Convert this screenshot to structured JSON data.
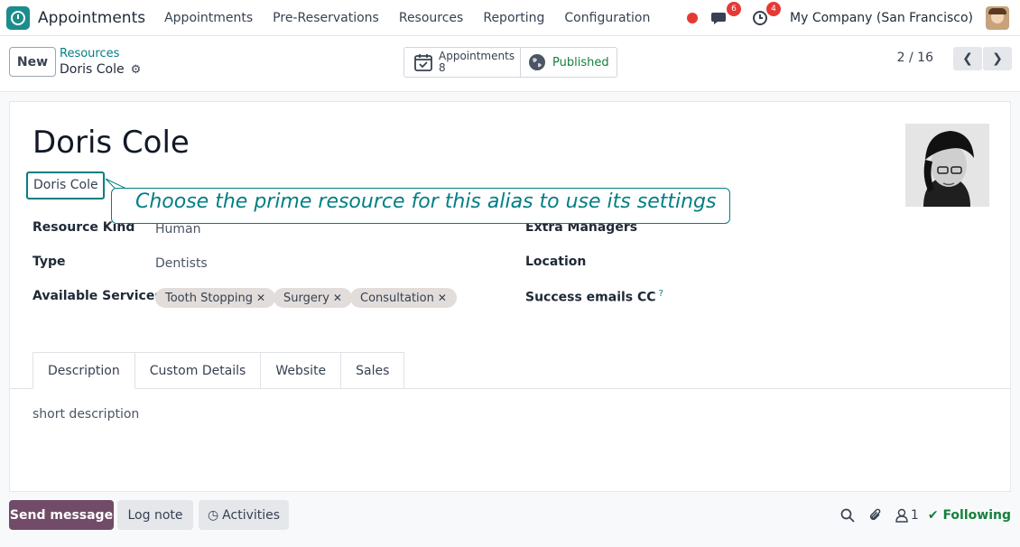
{
  "navbar": {
    "app_name": "Appointments",
    "menu": [
      "Appointments",
      "Pre-Reservations",
      "Resources",
      "Reporting",
      "Configuration"
    ],
    "messages_count": "6",
    "activities_count": "4",
    "company": "My Company (San Francisco)"
  },
  "control": {
    "new_label": "New",
    "breadcrumb_parent": "Resources",
    "breadcrumb_current": "Doris Cole",
    "smart_appointments_label": "Appointments",
    "smart_appointments_count": "8",
    "published_label": "Published",
    "pager": "2 / 16"
  },
  "form": {
    "title": "Doris Cole",
    "alias": "Doris Cole",
    "resource_kind_label": "Resource Kind",
    "resource_kind_value": "Human",
    "type_label": "Type",
    "type_value": "Dentists",
    "services_label": "Available Services",
    "services": [
      "Tooth Stopping",
      "Surgery",
      "Consultation"
    ],
    "extra_managers_label": "Extra Managers",
    "location_label": "Location",
    "success_emails_label": "Success emails CC",
    "help_mark": "?",
    "tabs": [
      "Description",
      "Custom Details",
      "Website",
      "Sales"
    ],
    "description_placeholder": "short description"
  },
  "tooltip": {
    "text": "Choose the prime resource for this alias to use its settings"
  },
  "chatter": {
    "send_message": "Send message",
    "log_note": "Log note",
    "activities": "Activities",
    "followers_count": "1",
    "following": "Following"
  },
  "colors": {
    "brand": "#714b67",
    "accent": "#017e84",
    "badge": "#e53935",
    "published": "#15803d"
  }
}
